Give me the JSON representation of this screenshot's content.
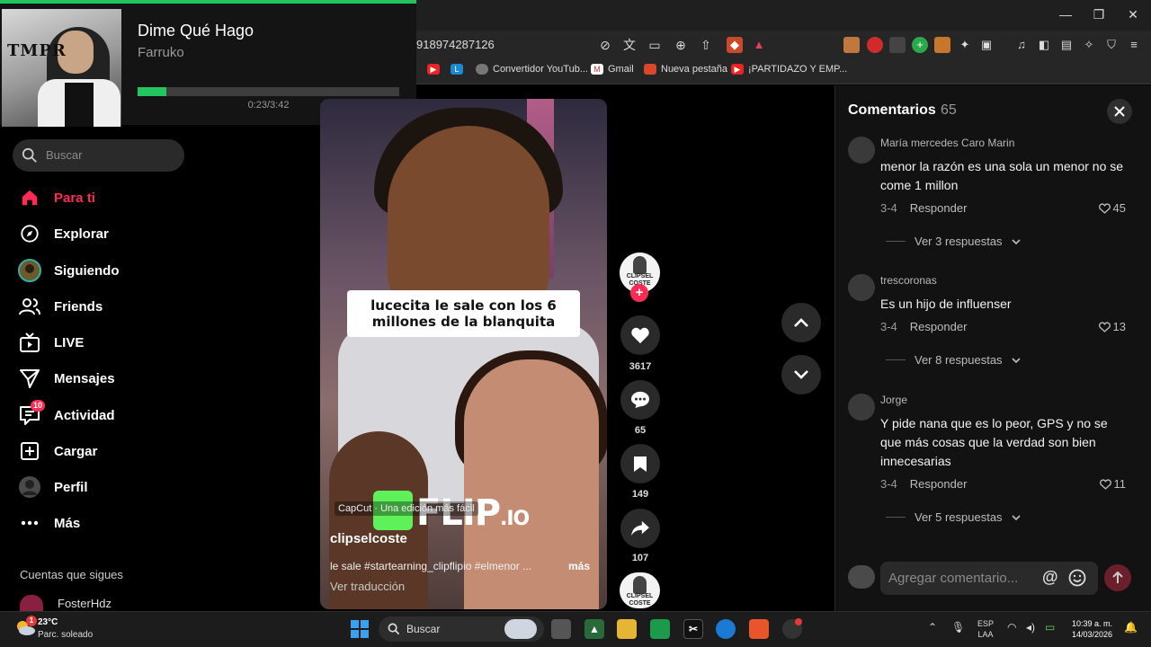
{
  "music": {
    "album_text": "TMPR",
    "title": "Dime Qué Hago",
    "artist": "Farruko",
    "progress_fraction": 0.11,
    "time": "0:23/3:42",
    "accent": "#22c55e"
  },
  "browser": {
    "url": "918974287126",
    "minimize": "—",
    "maximize": "❐",
    "close": "✕",
    "bookmarks": [
      {
        "label": "Convertidor YouTub..."
      },
      {
        "label": "Gmail"
      },
      {
        "label": "Nueva pestaña"
      },
      {
        "label": "¡PARTIDAZO Y EMP..."
      }
    ]
  },
  "sidebar": {
    "search_placeholder": "Buscar",
    "items": [
      {
        "label": "Para ti",
        "icon": "home-icon",
        "active": true
      },
      {
        "label": "Explorar",
        "icon": "compass-icon"
      },
      {
        "label": "Siguiendo",
        "icon": "following-avatar-icon"
      },
      {
        "label": "Friends",
        "icon": "friends-icon"
      },
      {
        "label": "LIVE",
        "icon": "live-tv-icon"
      },
      {
        "label": "Mensajes",
        "icon": "send-icon"
      },
      {
        "label": "Actividad",
        "icon": "activity-icon",
        "badge": "10"
      },
      {
        "label": "Cargar",
        "icon": "upload-icon"
      },
      {
        "label": "Perfil",
        "icon": "profile-avatar-icon"
      },
      {
        "label": "Más",
        "icon": "more-icon"
      }
    ],
    "following_title": "Cuentas que sigues",
    "following_user": "FosterHdz"
  },
  "video": {
    "caption_line1": "lucecita le sale con los 6",
    "caption_line2": "millones de la blanquita",
    "watermark": "FLIP",
    "watermark_suffix": ".IO",
    "capcut": "CapCut · Una edición más fácil",
    "username": "clipselcoste",
    "description": "le sale #startearning_clipflipio #elmenor ...",
    "more": "más",
    "translate": "Ver traducción",
    "creator_badge": "CLIPSEL COSTE"
  },
  "actions": {
    "likes": "3617",
    "comments": "65",
    "saves": "149",
    "shares": "107"
  },
  "comments": {
    "title": "Comentarios",
    "count": "65",
    "items": [
      {
        "author": "María mercedes Caro Marin",
        "text": "menor la razón es una sola un menor no se come 1 millon",
        "date": "3-4",
        "reply": "Responder",
        "likes": "45",
        "replies": "Ver 3 respuestas"
      },
      {
        "author": "trescoronas",
        "text": "Es un hijo de influenser",
        "date": "3-4",
        "reply": "Responder",
        "likes": "13",
        "replies": "Ver 8 respuestas"
      },
      {
        "author": "Jorge",
        "text": "Y pide nana que es lo peor, GPS y no se que más cosas que la verdad son bien innecesarias",
        "date": "3-4",
        "reply": "Responder",
        "likes": "11",
        "replies": "Ver 5 respuestas"
      }
    ],
    "input_placeholder": "Agregar comentario...",
    "at_symbol": "@"
  },
  "taskbar": {
    "weather_badge": "1",
    "temperature": "23°C",
    "condition": "Parc. soleado",
    "search_placeholder": "Buscar",
    "lang_line1": "ESP",
    "lang_line2": "LAA",
    "time": "10:39 a. m.",
    "date": "14/03/2026"
  }
}
